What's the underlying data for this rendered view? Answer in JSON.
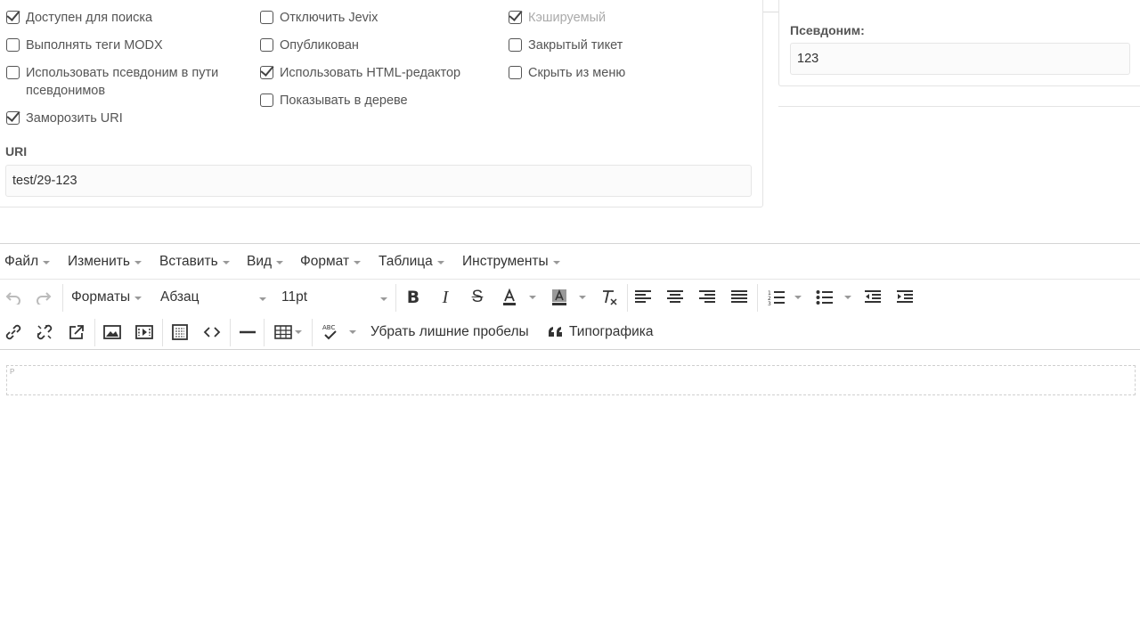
{
  "settings": {
    "col1": [
      {
        "label": "Доступен для поиска",
        "checked": true
      },
      {
        "label": "Выполнять теги MODX",
        "checked": false
      },
      {
        "label": "Использовать псевдоним в пути псевдонимов",
        "checked": false
      },
      {
        "label": "Заморозить URI",
        "checked": true
      }
    ],
    "col2": [
      {
        "label": "Отключить Jevix",
        "checked": false
      },
      {
        "label": "Опубликован",
        "checked": false
      },
      {
        "label": "Использовать HTML-редактор",
        "checked": true
      },
      {
        "label": "Показывать в дереве",
        "checked": false
      }
    ],
    "col3": [
      {
        "label": "Кэшируемый",
        "checked": true
      },
      {
        "label": "Закрытый тикет",
        "checked": false
      },
      {
        "label": "Скрыть из меню",
        "checked": false
      }
    ],
    "uri_label": "URI",
    "uri_value": "test/29-123"
  },
  "alias": {
    "label": "Псевдоним:",
    "value": "123"
  },
  "editor": {
    "menu": [
      "Файл",
      "Изменить",
      "Вставить",
      "Вид",
      "Формат",
      "Таблица",
      "Инструменты"
    ],
    "formats_label": "Форматы",
    "block_format": "Абзац",
    "font_size": "11pt",
    "remove_spaces_label": "Убрать лишние пробелы",
    "typography_label": "Типографика",
    "paragraph_marker": "P"
  },
  "colors": {
    "primary": "#1f9a8b"
  }
}
